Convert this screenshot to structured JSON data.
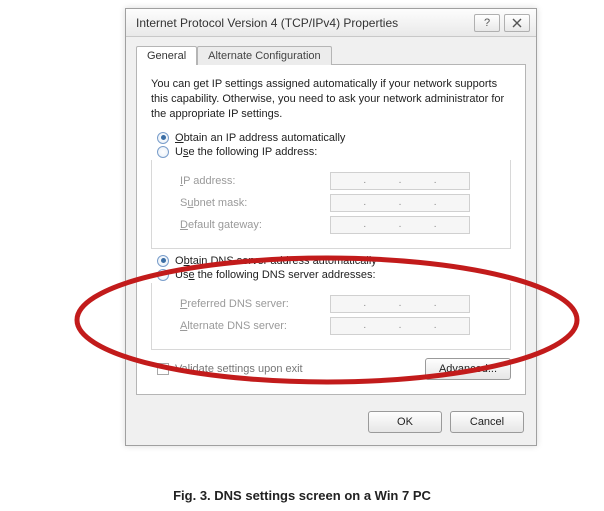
{
  "window": {
    "title": "Internet Protocol Version 4 (TCP/IPv4) Properties"
  },
  "tabs": {
    "general": "General",
    "alternate": "Alternate Configuration"
  },
  "intro": "You can get IP settings assigned automatically if your network supports this capability. Otherwise, you need to ask your network administrator for the appropriate IP settings.",
  "ip": {
    "auto": "Obtain an IP address automatically",
    "manual": "Use the following IP address:",
    "addr_label": "IP address:",
    "mask_label": "Subnet mask:",
    "gw_label": "Default gateway:"
  },
  "dns": {
    "auto": "Obtain DNS server address automatically",
    "manual": "Use the following DNS server addresses:",
    "pref_label": "Preferred DNS server:",
    "alt_label": "Alternate DNS server:"
  },
  "validate": "Validate settings upon exit",
  "buttons": {
    "advanced": "Advanced...",
    "ok": "OK",
    "cancel": "Cancel"
  },
  "caption": "Fig. 3. DNS settings screen on a Win 7 PC",
  "annotation": {
    "ellipse_color": "#c21b1b"
  }
}
